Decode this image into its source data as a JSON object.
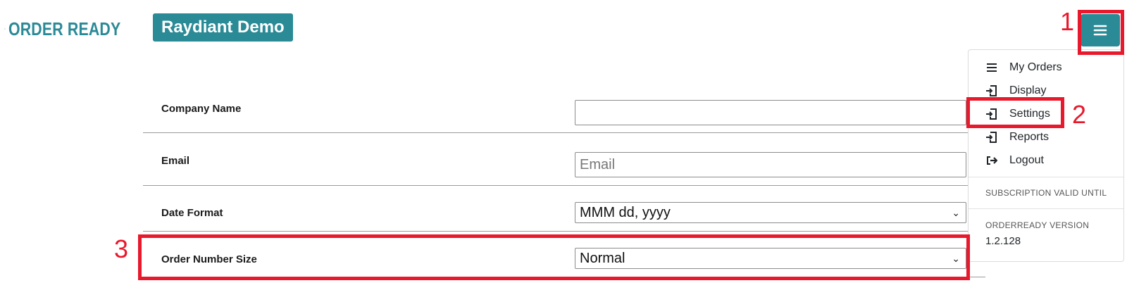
{
  "header": {
    "logo_text": "ORDER READY",
    "brand_badge": "Raydiant Demo"
  },
  "form": {
    "rows": [
      {
        "label": "Company Name",
        "value": ""
      },
      {
        "label": "Email",
        "placeholder": "Email"
      },
      {
        "label": "Date Format",
        "value": "MMM dd, yyyy"
      },
      {
        "label": "Order Number Size",
        "value": "Normal"
      }
    ]
  },
  "menu": {
    "items": [
      {
        "label": "My Orders",
        "icon": "list-icon"
      },
      {
        "label": "Display",
        "icon": "sign-in-icon"
      },
      {
        "label": "Settings",
        "icon": "sign-in-icon"
      },
      {
        "label": "Reports",
        "icon": "sign-in-icon"
      },
      {
        "label": "Logout",
        "icon": "sign-out-icon"
      }
    ],
    "subscription_caption": "SUBSCRIPTION VALID UNTIL",
    "version_caption": "ORDERREADY VERSION",
    "version_value": "1.2.128"
  },
  "annotations": [
    "1",
    "2",
    "3"
  ],
  "colors": {
    "brand": "#2a8a96",
    "annotation": "#e8192c"
  }
}
